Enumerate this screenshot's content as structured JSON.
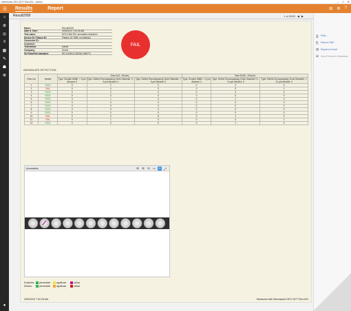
{
  "window": {
    "title": "Intermotec OEx 2077 ReLoS1 - Admin",
    "controls": [
      "–",
      "□",
      "✕"
    ]
  },
  "appbar": {
    "menu_icon": "menu-icon",
    "tabs": [
      {
        "label": "Results"
      },
      {
        "label": "Report"
      }
    ]
  },
  "subbar": {
    "title": "Result2009",
    "pager": "1 of 2009"
  },
  "info": [
    {
      "k": "Name:",
      "v": "Result2009"
    },
    {
      "k": "Date & Time:",
      "v": "4/09/2020 7:52:26 AM"
    },
    {
      "k": "Test name:",
      "v": "MT12-MM IEC anomalies detection"
    },
    {
      "k": "Device ID, Fixture ID:",
      "v": "Fibertu-10.7695, not defined"
    },
    {
      "k": "Connector ID:",
      "v": ""
    },
    {
      "k": "Customer:",
      "v": ""
    },
    {
      "k": "Technician:",
      "v": "Admin"
    },
    {
      "k": "Company:",
      "v": "Sumix"
    },
    {
      "k": "SD Pass/Fail standard:",
      "v": "IEC 61300-3-35:Ed2 MM PC"
    }
  ],
  "verdict": "FAIL",
  "anomalies_title": "ANOMALIES DETECTION",
  "table": {
    "zoneA": "Zone A (0 - 65 µm)",
    "zoneB": "Zone B (65 - 115 µm)",
    "headers": [
      "Fiber No",
      "Verdict",
      "Type: Scratch Width: < 3 µm Allowed: 0",
      "Type: Defect Encompassing Circle Diameter: 0 - 5 µm Allowed: 4",
      "Type: Defect Encompassing Circle Diameter: > 5 µm Allowed: 0",
      "Type: Scratch Width: < 5 µm Allowed: 0",
      "Type: Defect Encompassing Circle Diameter: 5 - 10 µm Allowed: 5",
      "Type: Defect Encompassing Circle Diameter: > 10 µm Allowed: 0"
    ],
    "rows": [
      [
        "1",
        "PASS",
        "0",
        "2",
        "0",
        "0",
        "2",
        "0"
      ],
      [
        "2",
        "FAIL",
        "9",
        "0",
        "0",
        "0",
        "0",
        "1"
      ],
      [
        "3",
        "PASS",
        "0",
        "2",
        "0",
        "0",
        "0",
        "0"
      ],
      [
        "4",
        "PASS",
        "0",
        "0",
        "0",
        "0",
        "0",
        "0"
      ],
      [
        "5",
        "PASS",
        "0",
        "1",
        "0",
        "0",
        "1",
        "0"
      ],
      [
        "6",
        "PASS",
        "0",
        "0",
        "0",
        "0",
        "0",
        "0"
      ],
      [
        "7",
        "PASS",
        "0",
        "0",
        "0",
        "0",
        "0",
        "0"
      ],
      [
        "8",
        "PASS",
        "0",
        "0",
        "0",
        "0",
        "0",
        "0"
      ],
      [
        "9",
        "PASS",
        "0",
        "0",
        "0",
        "0",
        "0",
        "0"
      ],
      [
        "10",
        "FAIL",
        "0",
        "0",
        "8",
        "0",
        "1",
        "0"
      ],
      [
        "11",
        "FAIL",
        "0",
        "1",
        "0",
        "0",
        "0",
        "1"
      ],
      [
        "12",
        "PASS",
        "0",
        "0",
        "0",
        "0",
        "1",
        "0"
      ]
    ]
  },
  "anomalies_panel": {
    "title": "Anomalies",
    "tools": [
      "zoom-in-icon",
      "zoom-in-alt-icon",
      "zoom-out-icon",
      "fit-icon",
      "search-active-icon",
      "expand-icon"
    ],
    "fibers": 12,
    "marked_fiber": 2
  },
  "legend": {
    "rows": [
      {
        "label": "Scratches:",
        "items": [
          {
            "color": "#2fb25a",
            "text": "permissible"
          },
          {
            "color": "#f2df3a",
            "text": "significant"
          },
          {
            "color": "#c0158d",
            "text": "critical"
          }
        ]
      },
      {
        "label": "Defects:",
        "items": [
          {
            "color": "#2fb25a",
            "text": "permissible"
          },
          {
            "color": "#f5a623",
            "text": "significant"
          },
          {
            "color": "#c81e1e",
            "text": "critical"
          }
        ]
      }
    ]
  },
  "footer": {
    "left": "4/09/2020 7:52:26 AM",
    "right": "Measured with Maxinspect OEV 2077 ReLoS1I"
  },
  "right_actions": [
    {
      "label": "Print...",
      "icon": "printer-icon",
      "enabled": true
    },
    {
      "label": "Print to PDF",
      "icon": "pdf-icon",
      "enabled": true
    },
    {
      "label": "Export to Excel",
      "icon": "excel-icon",
      "enabled": true
    },
    {
      "label": "Send Result to Database",
      "icon": "database-icon",
      "enabled": false
    }
  ]
}
